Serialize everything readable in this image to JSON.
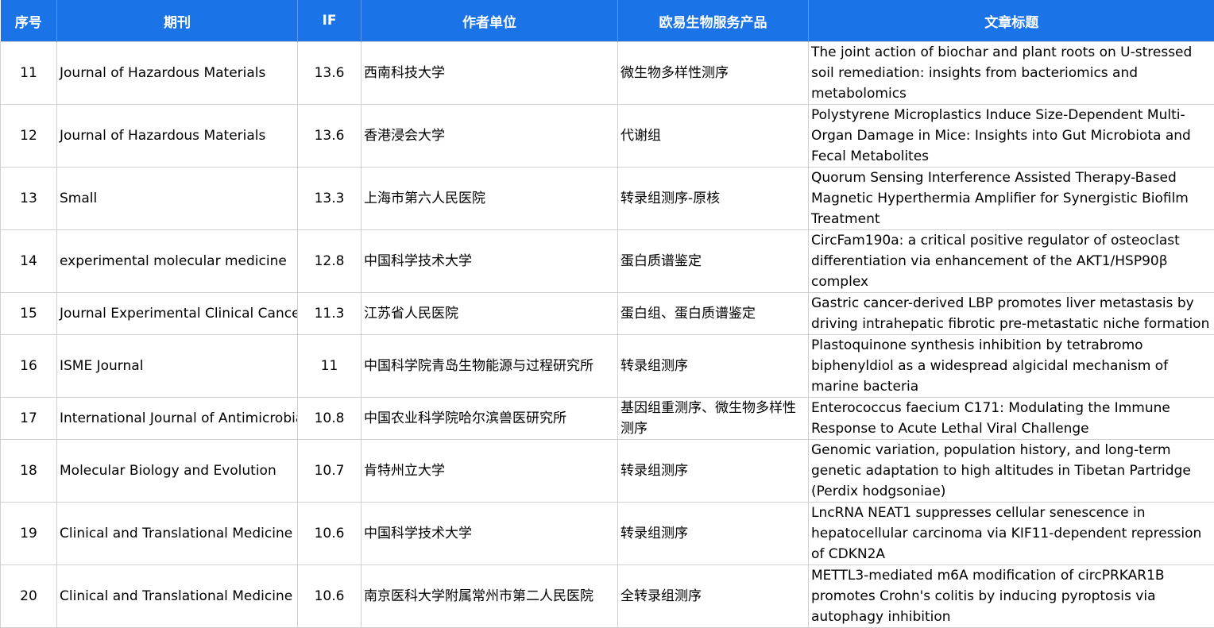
{
  "headers": [
    "序号",
    "期刊",
    "IF",
    "作者单位",
    "欧易生物服务产品",
    "文章标题"
  ],
  "rows": [
    {
      "no": "11",
      "journal": "Journal of Hazardous Materials",
      "if": "13.6",
      "unit": "西南科技大学",
      "product": "微生物多样性测序",
      "title": "The joint action of biochar and plant roots on U-stressed soil remediation: insights from bacteriomics and metabolomics"
    },
    {
      "no": "12",
      "journal": "Journal of Hazardous Materials",
      "if": "13.6",
      "unit": "香港浸会大学",
      "product": "代谢组",
      "title": "Polystyrene Microplastics Induce Size-Dependent Multi-Organ Damage in Mice: Insights into Gut Microbiota and Fecal Metabolites"
    },
    {
      "no": "13",
      "journal": "Small",
      "if": "13.3",
      "unit": "上海市第六人民医院",
      "product": "转录组测序-原核",
      "title": "Quorum Sensing Interference Assisted Therapy-Based Magnetic Hyperthermia Amplifier for Synergistic Biofilm Treatment"
    },
    {
      "no": "14",
      "journal": "experimental molecular medicine",
      "if": "12.8",
      "unit": "中国科学技术大学",
      "product": "蛋白质谱鉴定",
      "title": "CircFam190a: a critical positive regulator of osteoclast differentiation via enhancement of the AKT1/HSP90β complex"
    },
    {
      "no": "15",
      "journal": "Journal Experimental Clinical Cancer",
      "if": "11.3",
      "unit": "江苏省人民医院",
      "product": "蛋白组、蛋白质谱鉴定",
      "title": "Gastric cancer-derived LBP promotes liver metastasis by driving intrahepatic fibrotic pre-metastatic niche formation"
    },
    {
      "no": "16",
      "journal": "ISME Journal",
      "if": "11",
      "unit": "中国科学院青岛生物能源与过程研究所",
      "product": "转录组测序",
      "title": "Plastoquinone synthesis inhibition by tetrabromo biphenyldiol as a widespread algicidal mechanism of marine bacteria"
    },
    {
      "no": "17",
      "journal": "International Journal of Antimicrobia",
      "if": "10.8",
      "unit": "中国农业科学院哈尔滨兽医研究所",
      "product": "基因组重测序、微生物多样性测序",
      "title": "Enterococcus faecium C171: Modulating the Immune Response to Acute Lethal Viral Challenge"
    },
    {
      "no": "18",
      "journal": "Molecular Biology and Evolution",
      "if": "10.7",
      "unit": "肯特州立大学",
      "product": "转录组测序",
      "title": "Genomic variation, population history, and long-term genetic adaptation to high altitudes in Tibetan Partridge (Perdix hodgsoniae)"
    },
    {
      "no": "19",
      "journal": "Clinical and Translational Medicine",
      "if": "10.6",
      "unit": "中国科学技术大学",
      "product": "转录组测序",
      "title": "LncRNA NEAT1 suppresses cellular senescence in hepatocellular carcinoma via KIF11-dependent repression of CDKN2A"
    },
    {
      "no": "20",
      "journal": "Clinical and Translational Medicine",
      "if": "10.6",
      "unit": "南京医科大学附属常州市第二人民医院",
      "product": "全转录组测序",
      "title": "METTL3-mediated m6A modification of circPRKAR1B promotes Crohn's colitis by inducing pyroptosis via autophagy inhibition"
    }
  ]
}
